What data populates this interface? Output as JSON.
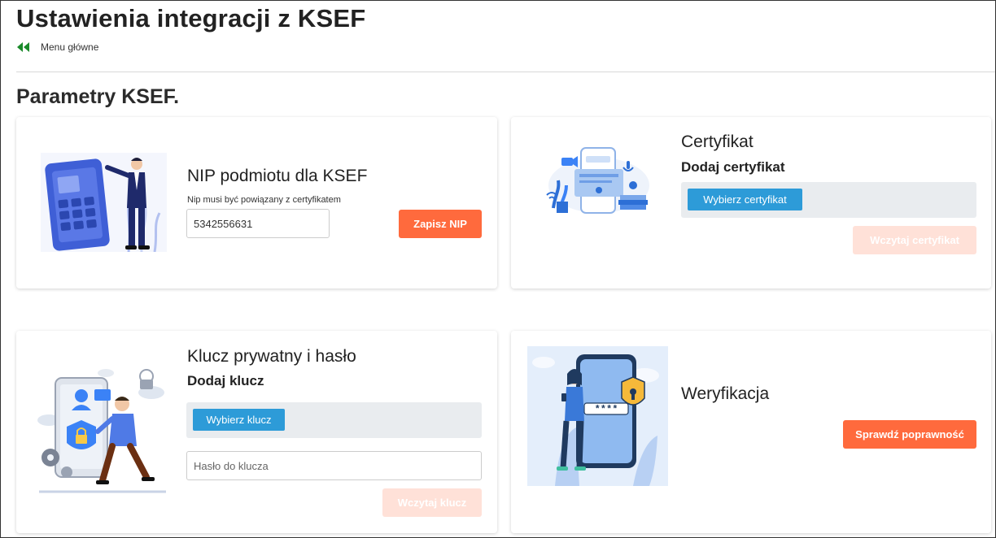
{
  "header": {
    "title": "Ustawienia integracji z KSEF",
    "back_label": "Menu główne"
  },
  "section_title": "Parametry KSEF.",
  "nip_card": {
    "title": "NIP podmiotu dla KSEF",
    "hint": "Nip musi być powiązany z certyfikatem",
    "nip_value": "5342556631",
    "save_button": "Zapisz NIP"
  },
  "cert_card": {
    "title": "Certyfikat",
    "subtitle": "Dodaj certyfikat",
    "choose_button": "Wybierz certyfikat",
    "load_button": "Wczytaj certyfikat"
  },
  "key_card": {
    "title": "Klucz prywatny i hasło",
    "subtitle": "Dodaj klucz",
    "choose_button": "Wybierz klucz",
    "password_placeholder": "Hasło do klucza",
    "load_button": "Wczytaj klucz"
  },
  "verify_card": {
    "title": "Weryfikacja",
    "check_button": "Sprawdź poprawność",
    "phone_code": "****"
  },
  "colors": {
    "accent_orange": "#ff6a3d",
    "accent_orange_disabled": "#ffe1d8",
    "file_button_blue": "#2d9bd8",
    "back_arrow_green": "#1a8a2a",
    "illustration_blue": "#3f5fd6"
  },
  "icons": {
    "back": "double-chevron-left-icon",
    "nip_illustration": "touchscreen-presenter-illustration",
    "cert_illustration": "phone-certificate-illustration",
    "key_illustration": "security-lock-person-illustration",
    "verify_illustration": "phone-shield-password-illustration"
  }
}
